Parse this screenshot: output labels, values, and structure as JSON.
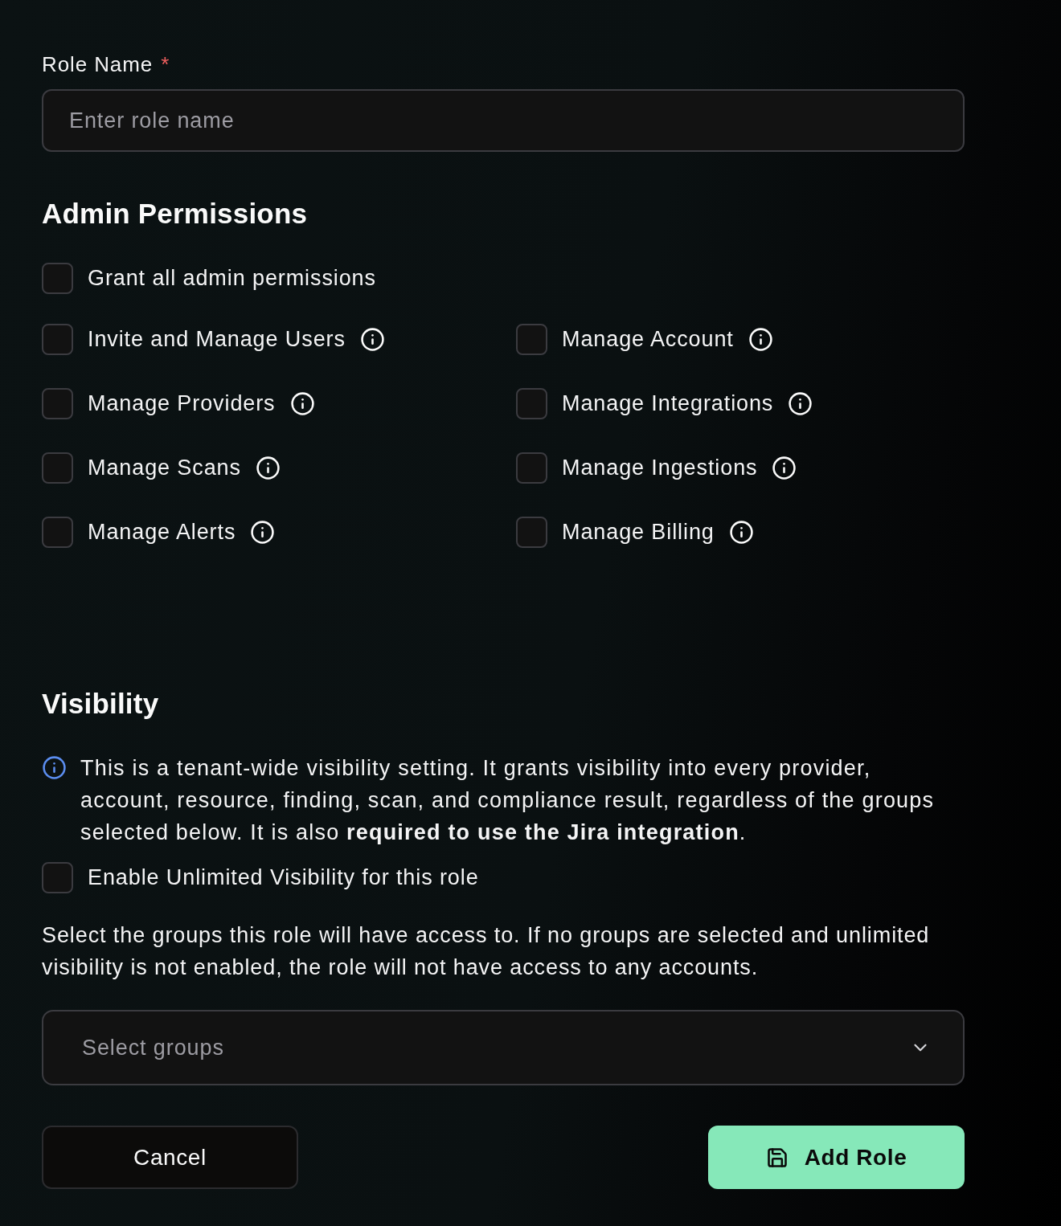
{
  "role_name": {
    "label": "Role Name",
    "required_mark": "*",
    "placeholder": "Enter role name"
  },
  "admin_permissions": {
    "title": "Admin Permissions",
    "grant_all": {
      "label": "Grant all admin permissions",
      "checked": false
    },
    "items": [
      {
        "label": "Invite and Manage Users",
        "checked": false
      },
      {
        "label": "Manage Account",
        "checked": false
      },
      {
        "label": "Manage Providers",
        "checked": false
      },
      {
        "label": "Manage Integrations",
        "checked": false
      },
      {
        "label": "Manage Scans",
        "checked": false
      },
      {
        "label": "Manage Ingestions",
        "checked": false
      },
      {
        "label": "Manage Alerts",
        "checked": false
      },
      {
        "label": "Manage Billing",
        "checked": false
      }
    ]
  },
  "visibility": {
    "title": "Visibility",
    "info": "This is a tenant-wide visibility setting. It grants visibility into every provider, account, resource, finding, scan, and compliance result, regardless of the groups selected below. It is also **required to use the Jira integration**.",
    "unlimited": {
      "label": "Enable Unlimited Visibility for this role",
      "checked": false
    },
    "description": "Select the groups this role will have access to. If no groups are selected and unlimited visibility is not enabled, the role will not have access to any accounts.",
    "groups_select": {
      "placeholder": "Select groups"
    }
  },
  "actions": [
    {
      "label": "Cancel",
      "kind": "secondary"
    },
    {
      "label": "Add Role",
      "kind": "primary"
    }
  ]
}
